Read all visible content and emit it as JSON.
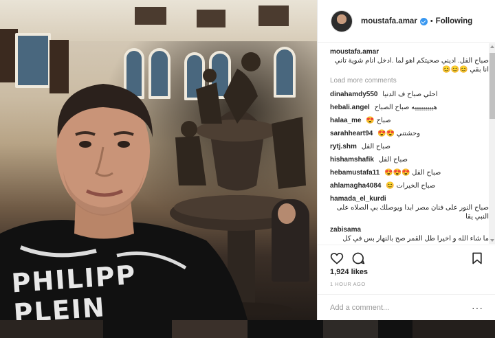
{
  "post": {
    "username": "moustafa.amar",
    "follow_status": "Following",
    "caption": "صباح الفل. اديني صحيتكم اهو لما .ادخل انام شوية تاني انا بقي",
    "caption_emoji": "😊😊😊",
    "load_more": "Load more comments",
    "likes": "1,924 likes",
    "time": "1 HOUR AGO",
    "add_comment_placeholder": "Add a comment...",
    "more_options": "···"
  },
  "comments": [
    {
      "user": "dinahamdy550",
      "text": "احلي صباح ف الدنيا"
    },
    {
      "user": "hebali.angel",
      "text": "هيييييييييه صباح الصباح"
    },
    {
      "user": "halaa_me",
      "text": "صباح 😍"
    },
    {
      "user": "sarahheart94",
      "text": "وحشتني 😍😍"
    },
    {
      "user": "rytj.shm",
      "text": "صباح الفل"
    },
    {
      "user": "hishamshafik",
      "text": "صباح الفل"
    },
    {
      "user": "hebamustafa11",
      "text": "صباح الفل 😍😍😍"
    },
    {
      "user": "ahlamagha4084",
      "text": "صباح الخيرات 😊"
    },
    {
      "user": "hamada_el_kurdi",
      "text": "صباح النور على فنان مصر ابدا ويوصلك بي الصلاه على النبي يقا"
    },
    {
      "user": "zabisama",
      "text": "ما شاء الله و اخيرا طل القمر صح بالنهار بس في كل الاوقات و كل الحالات قمر وحشتنا يا قمر صباح الخير و الهنا و السرور عليك و على كل مصر"
    }
  ],
  "photo": {
    "shirt_text": "PHILIPP PLEIN"
  },
  "colors": {
    "verified_blue": "#3897f0",
    "text_dark": "#262626",
    "text_muted": "#999999"
  },
  "icons": [
    "heart-icon",
    "comment-icon",
    "bookmark-icon",
    "verified-badge-icon"
  ]
}
